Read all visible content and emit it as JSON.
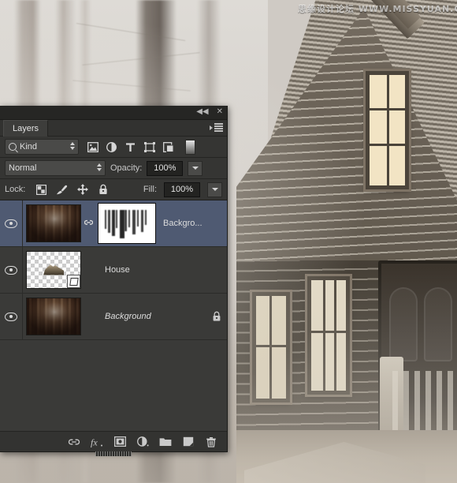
{
  "watermark": "思缘设计论坛 WWW.MISSYUAN.COM",
  "panel": {
    "titlebar": {
      "collapse_label": "◀◀",
      "close_label": "✕"
    },
    "tab": "Layers",
    "menu_icon": "panel-menu-icon",
    "filter": {
      "kind_label": "Kind",
      "search_icon": "search-icon",
      "icons": [
        {
          "name": "filter-pixel-layers-icon",
          "title": "Pixel layers"
        },
        {
          "name": "filter-adjustment-layers-icon",
          "title": "Adjustment layers"
        },
        {
          "name": "filter-type-layers-icon",
          "title": "Type layers"
        },
        {
          "name": "filter-shape-layers-icon",
          "title": "Shape layers"
        },
        {
          "name": "filter-smart-object-layers-icon",
          "title": "Smart objects"
        }
      ],
      "toggle_icon": "filter-enable-toggle-icon"
    },
    "blend": {
      "mode": "Normal",
      "opacity_label": "Opacity:",
      "opacity_value": "100%"
    },
    "lock": {
      "label": "Lock:",
      "icons": [
        {
          "name": "lock-transparent-pixels-icon"
        },
        {
          "name": "lock-image-pixels-icon"
        },
        {
          "name": "lock-position-icon"
        },
        {
          "name": "lock-all-icon"
        }
      ],
      "fill_label": "Fill:",
      "fill_value": "100%"
    },
    "layers": [
      {
        "name": "Backgro...",
        "visible": true,
        "selected": true,
        "thumb": "forest",
        "has_mask": true,
        "mask_linked": true,
        "locked": false,
        "italic": false
      },
      {
        "name": "House",
        "visible": true,
        "selected": false,
        "thumb": "transparent-house",
        "has_mask": false,
        "mask_linked": false,
        "locked": false,
        "italic": false,
        "smart_object_badge": true
      },
      {
        "name": "Background",
        "visible": true,
        "selected": false,
        "thumb": "forest",
        "has_mask": false,
        "mask_linked": false,
        "locked": true,
        "italic": true
      }
    ],
    "bottom_buttons": [
      {
        "name": "link-layers-button",
        "label": "link"
      },
      {
        "name": "layer-style-fx-button",
        "label": "fx"
      },
      {
        "name": "add-layer-mask-button",
        "label": "mask"
      },
      {
        "name": "new-adjustment-layer-button",
        "label": "adjustment"
      },
      {
        "name": "new-group-button",
        "label": "folder"
      },
      {
        "name": "new-layer-button",
        "label": "new"
      },
      {
        "name": "delete-layer-button",
        "label": "trash"
      }
    ]
  },
  "colors": {
    "panel_bg": "#353533",
    "list_bg": "#3a3a38",
    "selected_row": "#4f5a72",
    "text": "#dcdcdc",
    "titlebar": "#262624"
  }
}
